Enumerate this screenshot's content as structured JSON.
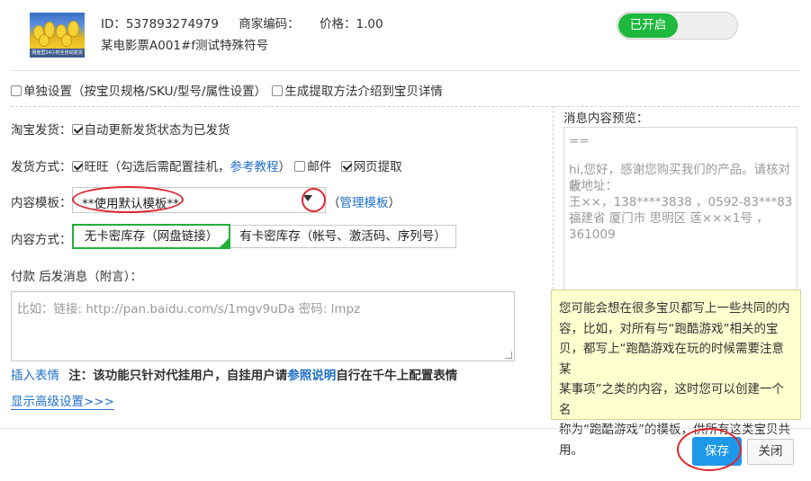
{
  "product": {
    "thumb_caption": "网盘里24小时全自动发货",
    "id_label": "ID：537893274979",
    "merchant_code_label": "商家编码：",
    "price_label": "价格：1.00",
    "name": "某电影票A001#f测试特殊符号",
    "status_toggle": "已开启"
  },
  "options": {
    "separate_settings": "单独设置（按宝贝规格/SKU/型号/属性设置）",
    "generate_method": "生成提取方法介绍到宝贝详情"
  },
  "form": {
    "taobao_ship_label": "淘宝发货：",
    "auto_update_label": "自动更新发货状态为已发货",
    "ship_method_label": "发货方式：",
    "wangwang_label": "旺旺（勾选后需配置挂机，",
    "tutorial_link": "参考教程",
    "wangwang_suffix": "）",
    "email_label": "邮件",
    "web_extract_label": "网页提取",
    "template_label": "内容模板：",
    "template_value": "**使用默认模板**",
    "manage_open": "（",
    "manage_link": "管理模板",
    "manage_close": "）",
    "content_method_label": "内容方式：",
    "seg_option_1": "无卡密库存（网盘链接）",
    "seg_option_2": "有卡密库存（帐号、激活码、序列号）",
    "post_pay_label": "付款 后发消息（附言）：",
    "message_placeholder": "比如：链接: http://pan.baidu.com/s/1mgv9uDa 密码: lmpz",
    "insert_emoji": "插入表情",
    "note_prefix": "注：该功能只针对代挂用户，自挂用户请",
    "note_link": "参照说明",
    "note_suffix": "自行在千牛上配置表情",
    "advanced_link": "显示高级设置>>>"
  },
  "preview": {
    "title": "消息内容预览：",
    "lines": [
      "==",
      "",
      "hi,您好，感谢您购买我们的产品。请核对收",
      "货地址：",
      "王××，138****3838 ，0592-83***83 ，",
      "福建省 厦门市 思明区 莲×××1号 ，",
      "361009"
    ]
  },
  "tooltip": {
    "text_lines": [
      "您可能会想在很多宝贝都写上一些共同的内",
      "容，比如，对所有与“跑酷游戏”相关的宝",
      "贝，都写上“跑酷游戏在玩的时候需要注意某",
      "某事项”之类的内容，这时您可以创建一个名",
      "称为“跑酷游戏”的模板，供所有这类宝贝共",
      "用。"
    ]
  },
  "footer": {
    "save_label": "保存",
    "close_label": "关闭"
  },
  "colors": {
    "toggle_on": "#1fb93e",
    "link": "#1f6fc5",
    "save_button": "#1e98ea",
    "annotation_red": "#e0262f",
    "tooltip_bg": "#ffffd0"
  }
}
